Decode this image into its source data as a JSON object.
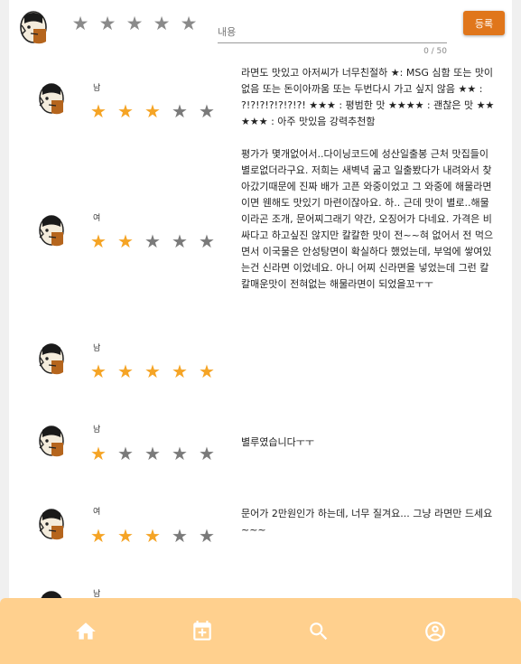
{
  "compose": {
    "placeholder": "내용",
    "counter": "0 / 50",
    "submit_label": "등록",
    "star_count": 5
  },
  "colors": {
    "accent": "#e0761b",
    "star_on": "#f5a425",
    "star_off": "#7a7a7a",
    "nav_bg": "#ffd08e"
  },
  "reviews": [
    {
      "gender": "남",
      "rating": 3,
      "text": "라면도 맛있고 아저씨가 너무친절하 ★: MSG 심함 또는 맛이없음 또는 돈이아까움 또는 두번다시 가고 싶지 않음 ★★ : ?!?!?!?!?!?!?! ★★★ : 평범한 맛 ★★★★ : 괜찮은 맛 ★★★★★ : 아주 맛있음 강력추천함"
    },
    {
      "gender": "여",
      "rating": 2,
      "text": "평가가 몇개없어서..다이닝코드에 성산일출봉 근처 맛집들이 별로없더라구요. 저희는 새벽녁 굶고 일출봤다가 내려와서 찾아갔기때문에 진짜 배가 고픈 와중이었고 그 와중에 해물라면이면 웬해도 맛있기 마련이잖아요. 하.. 근데 맛이 별로..해물이라곤 조개, 문어찌그래기 약간, 오징어가 다네요. 가격은 비싸다고 하고싶진 않지만 칼칼한 맛이 전~~혀 없어서 전 먹으면서 이국물은 안성탕면이 확실하다 했었는데, 부엌에 쌓여있는건 신라면 이었네요. 아니 어찌 신라면을 넣었는데 그런 칼칼매운맛이 전혀없는 해물라면이 되었을꼬ㅜㅜ"
    },
    {
      "gender": "남",
      "rating": 5,
      "text": ""
    },
    {
      "gender": "남",
      "rating": 1,
      "text": "별루였습니다ㅜㅜ"
    },
    {
      "gender": "여",
      "rating": 3,
      "text": "문어가 2만원인가 하는데, 너무 질겨요... 그냥 라면만 드세요~~~"
    },
    {
      "gender": "남",
      "rating": 0,
      "text": ""
    }
  ],
  "nav": [
    {
      "name": "home-icon"
    },
    {
      "name": "calendar-add-icon"
    },
    {
      "name": "search-icon"
    },
    {
      "name": "account-icon"
    }
  ]
}
